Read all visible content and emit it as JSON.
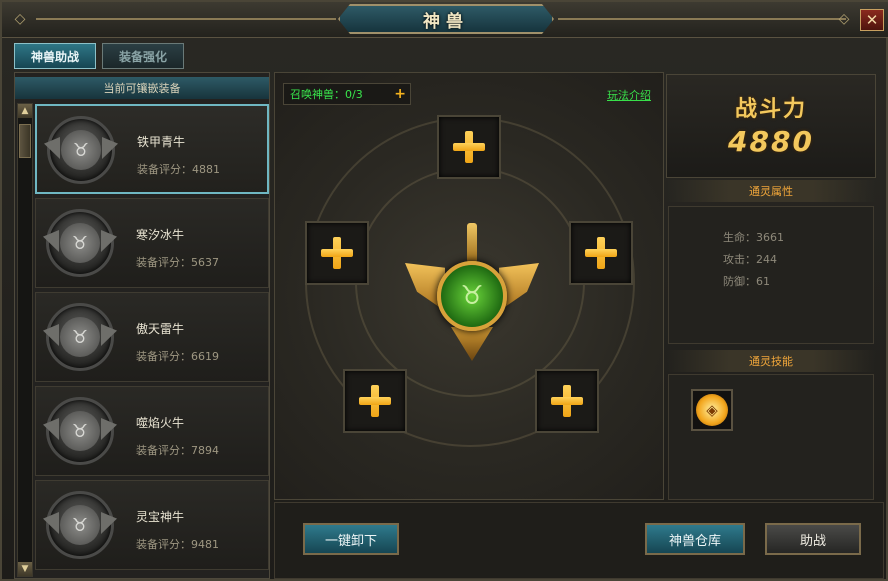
{
  "window": {
    "title": "神兽"
  },
  "tabs": [
    {
      "label": "神兽助战",
      "active": true
    },
    {
      "label": "装备强化",
      "active": false
    }
  ],
  "left_panel": {
    "header": "当前可镶嵌装备",
    "items": [
      {
        "name": "铁甲青牛",
        "score": "装备评分：4881",
        "selected": true
      },
      {
        "name": "寒汐冰牛",
        "score": "装备评分：5637",
        "selected": false
      },
      {
        "name": "傲天雷牛",
        "score": "装备评分：6619",
        "selected": false
      },
      {
        "name": "噬焰火牛",
        "score": "装备评分：7894",
        "selected": false
      },
      {
        "name": "灵宝神牛",
        "score": "装备评分：9481",
        "selected": false
      }
    ]
  },
  "center": {
    "summon_label": "召唤神兽：0/3",
    "summon_plus": "+",
    "help_link": "玩法介绍"
  },
  "right_panel": {
    "power_label": "战斗力",
    "power_value": "4880",
    "attr_header": "通灵属性",
    "attributes": [
      {
        "text": "生命：3661"
      },
      {
        "text": "攻击：244"
      },
      {
        "text": "防御：61"
      }
    ],
    "skill_header": "通灵技能"
  },
  "buttons": {
    "unload_all": "一键卸下",
    "warehouse": "神兽仓库",
    "assist": "助战"
  },
  "colors": {
    "accent_teal": "#2f7686",
    "gold": "#f3c85d",
    "green_text": "#39e64c"
  }
}
